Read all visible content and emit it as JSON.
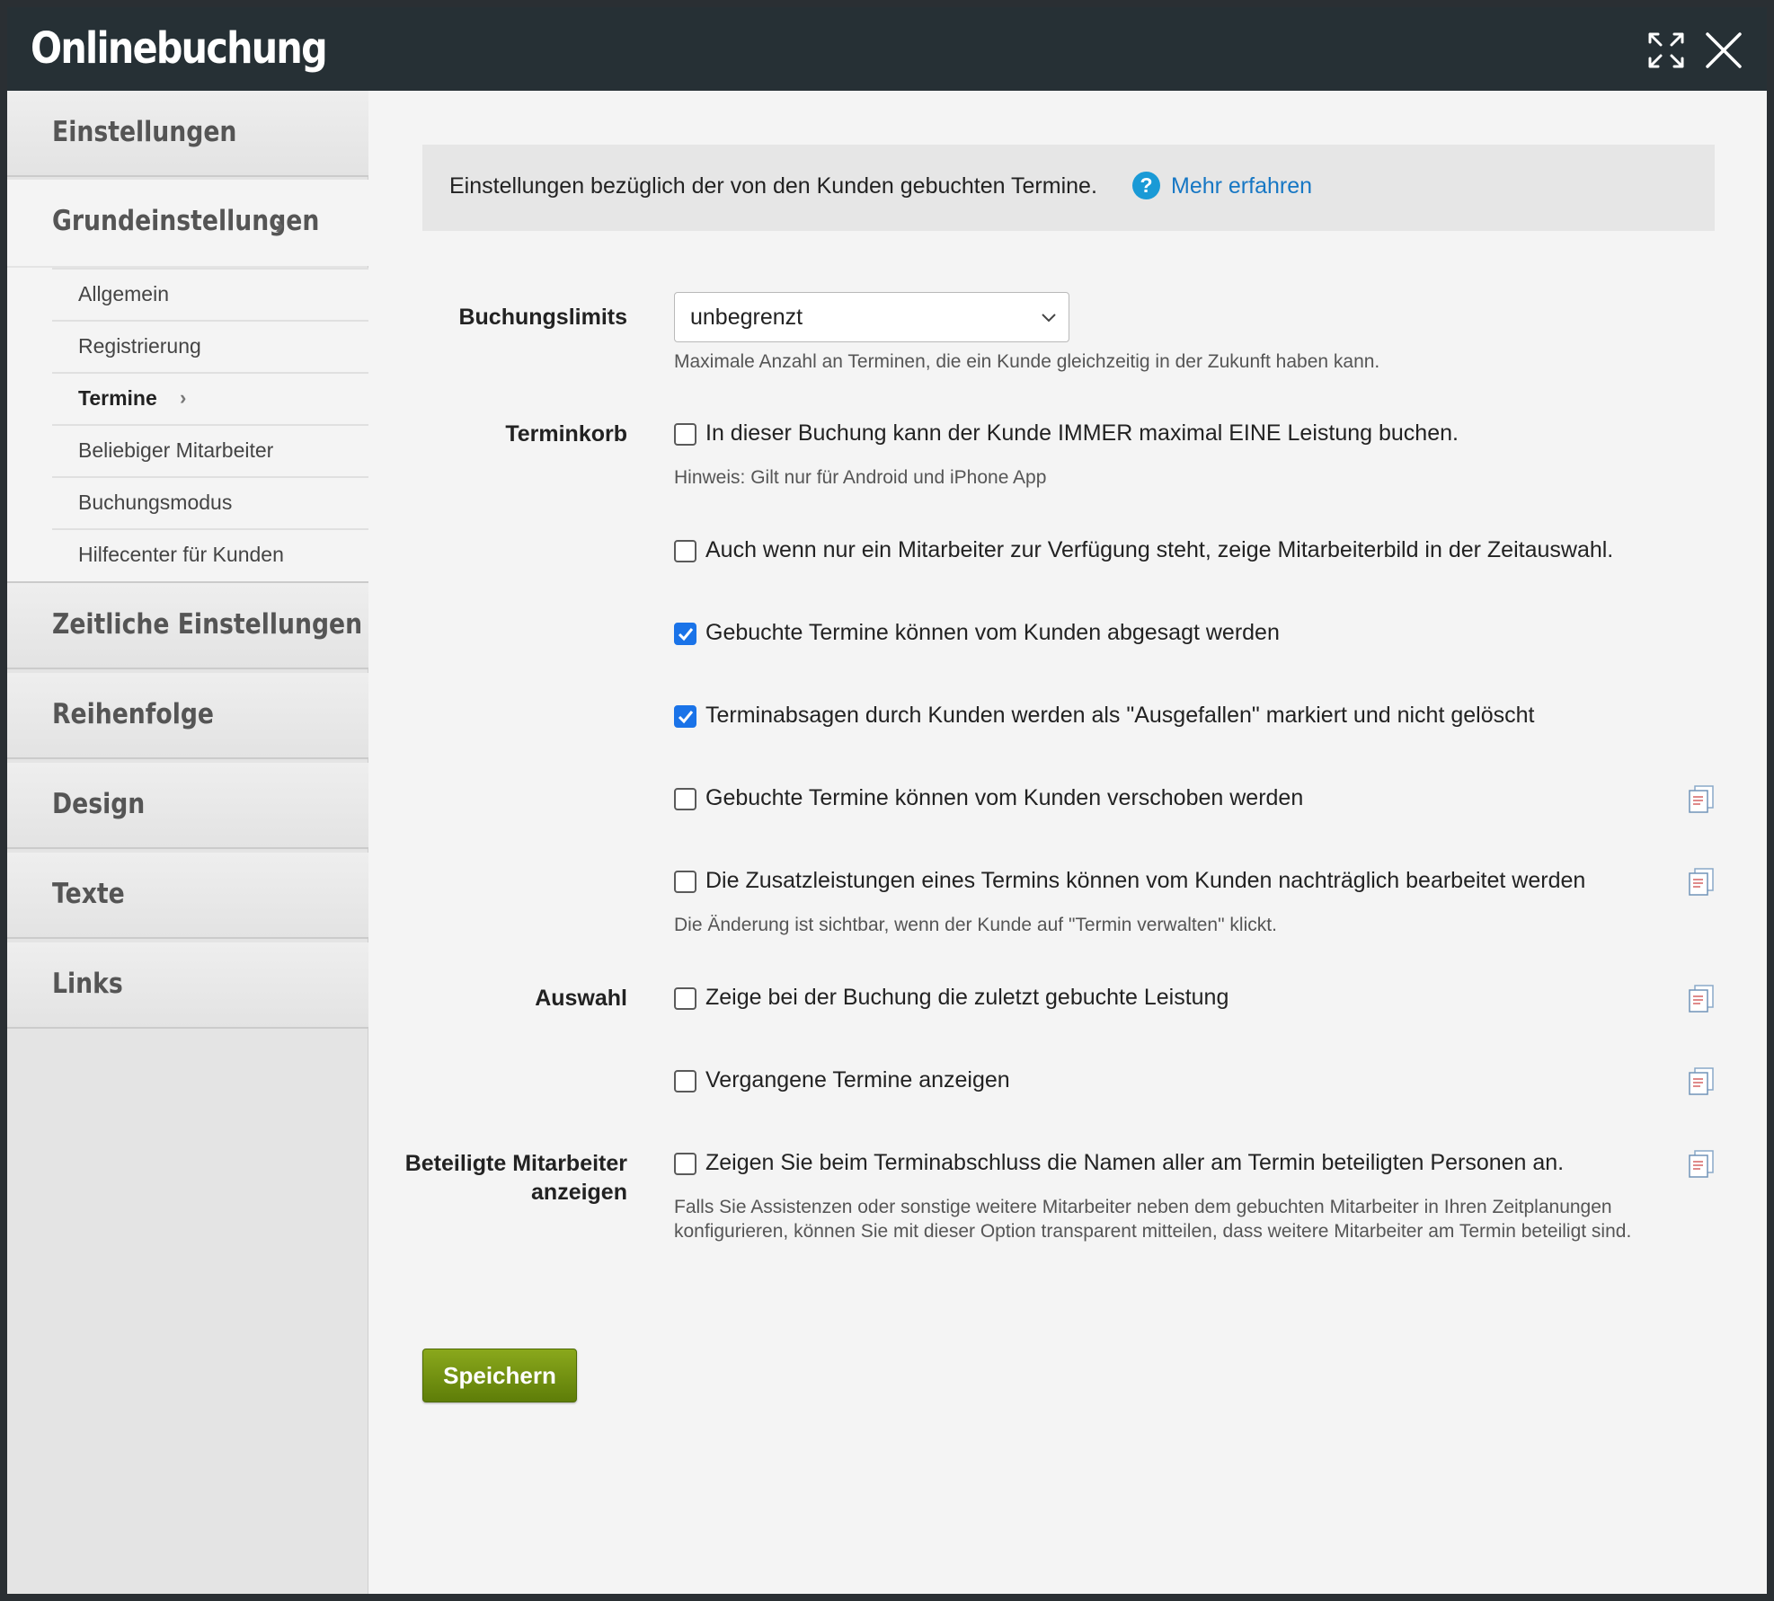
{
  "window": {
    "title": "Onlinebuchung",
    "expand_icon": "expand-icon",
    "close_icon": "close-icon"
  },
  "sidebar": {
    "sections": [
      {
        "label": "Einstellungen"
      },
      {
        "label": "Grundeinstellungen"
      },
      {
        "label": "Zeitliche Einstellungen"
      },
      {
        "label": "Reihenfolge"
      },
      {
        "label": "Design"
      },
      {
        "label": "Texte"
      },
      {
        "label": "Links"
      }
    ],
    "sub_items": [
      {
        "label": "Allgemein"
      },
      {
        "label": "Registrierung"
      },
      {
        "label": "Termine",
        "active": true
      },
      {
        "label": "Beliebiger Mitarbeiter"
      },
      {
        "label": "Buchungsmodus"
      },
      {
        "label": "Hilfecenter für Kunden"
      }
    ]
  },
  "info": {
    "text": "Einstellungen bezüglich der von den Kunden gebuchten Termine.",
    "help_icon": "?",
    "link": "Mehr erfahren"
  },
  "form": {
    "booking_limits": {
      "label": "Buchungslimits",
      "value": "unbegrenzt",
      "hint": "Maximale Anzahl an Terminen, die ein Kunde gleichzeitig in der Zukunft haben kann."
    },
    "basket": {
      "label": "Terminkorb",
      "options": [
        {
          "label": "In dieser Buchung kann der Kunde IMMER maximal EINE Leistung buchen.",
          "checked": false,
          "hint": "Hinweis: Gilt nur für Android und iPhone App"
        },
        {
          "label": "Auch wenn nur ein Mitarbeiter zur Verfügung steht, zeige Mitarbeiterbild in der Zeitauswahl.",
          "checked": false
        },
        {
          "label": "Gebuchte Termine können vom Kunden abgesagt werden",
          "checked": true
        },
        {
          "label": "Terminabsagen durch Kunden werden als \"Ausgefallen\" markiert und nicht gelöscht",
          "checked": true
        },
        {
          "label": "Gebuchte Termine können vom Kunden verschoben werden",
          "checked": false
        },
        {
          "label": "Die Zusatzleistungen eines Termins können vom Kunden nachträglich bearbeitet werden",
          "checked": false,
          "hint": "Die Änderung ist sichtbar, wenn der Kunde auf \"Termin verwalten\" klickt."
        }
      ]
    },
    "selection": {
      "label": "Auswahl",
      "options": [
        {
          "label": "Zeige bei der Buchung die zuletzt gebuchte Leistung",
          "checked": false
        },
        {
          "label": "Vergangene Termine anzeigen",
          "checked": false
        }
      ]
    },
    "staff": {
      "label_line1": "Beteiligte Mitarbeiter",
      "label_line2": "anzeigen",
      "option": {
        "label": "Zeigen Sie beim Terminabschluss die Namen aller am Termin beteiligten Personen an.",
        "checked": false
      },
      "hint_line1": "Falls Sie Assistenzen oder sonstige weitere Mitarbeiter neben dem gebuchten Mitarbeiter in Ihren Zeitplanungen",
      "hint_line2": "konfigurieren, können Sie mit dieser Option transparent mitteilen, dass weitere Mitarbeiter am Termin beteiligt sind."
    }
  },
  "actions": {
    "save_label": "Speichern"
  },
  "colors": {
    "titlebar": "#263035",
    "accent_link": "#1677c4",
    "checkbox_checked": "#1a73e8",
    "save_button": "#6f8e10"
  }
}
